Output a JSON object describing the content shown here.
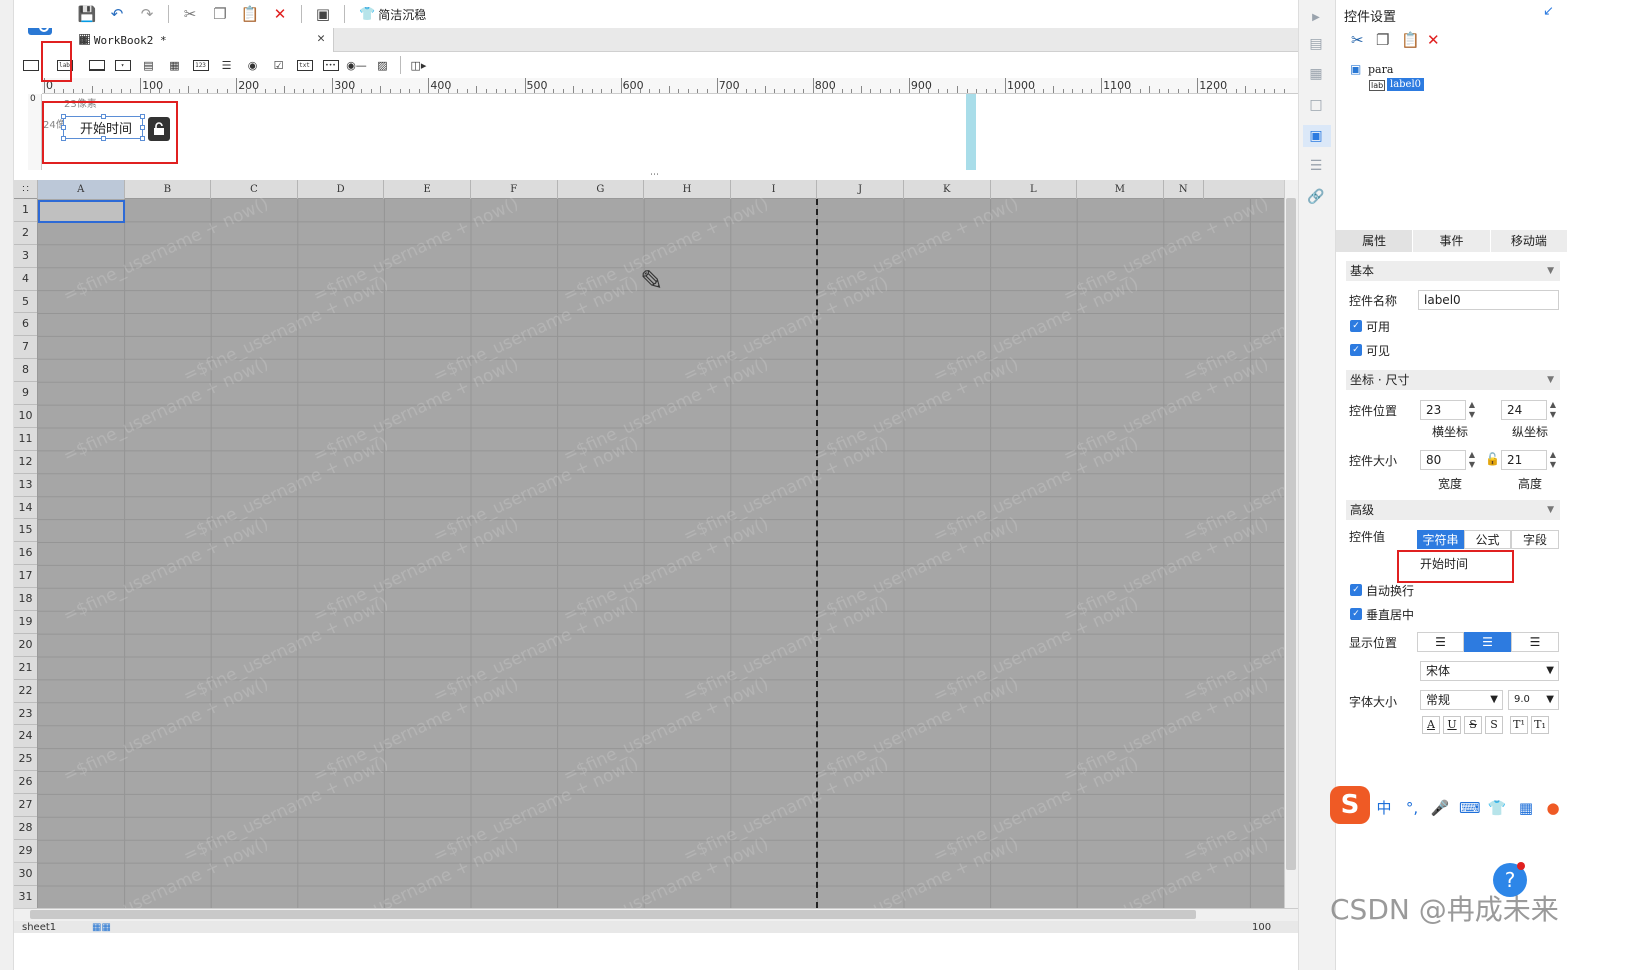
{
  "toolbar": {
    "simple_label": "简洁沉稳"
  },
  "tab": {
    "doc_name": "WorkBook2 *"
  },
  "ruler": {
    "labels": [
      "0",
      "100",
      "200",
      "300",
      "400",
      "500",
      "600",
      "700",
      "800",
      "900",
      "1000",
      "1100",
      "1200"
    ]
  },
  "param": {
    "label_text": "开始时间",
    "dim_h": "23像素",
    "dim_v": "24像素"
  },
  "grid": {
    "columns": [
      "A",
      "B",
      "C",
      "D",
      "E",
      "F",
      "G",
      "H",
      "I",
      "J",
      "K",
      "L",
      "M",
      "N"
    ],
    "rows": [
      "1",
      "2",
      "3",
      "4",
      "5",
      "6",
      "7",
      "8",
      "9",
      "10",
      "11",
      "12",
      "13",
      "14",
      "15",
      "16",
      "17",
      "18",
      "19",
      "20",
      "21",
      "22",
      "23",
      "24",
      "25",
      "26",
      "27",
      "28",
      "29",
      "30",
      "31"
    ],
    "watermark": "=$fine_username + now()"
  },
  "bottom": {
    "sheet_name": "sheet1",
    "zoom": "100"
  },
  "panel": {
    "title": "控件设置",
    "tree_root": "para",
    "tree_child": "label0",
    "tabs": [
      "属性",
      "事件",
      "移动端"
    ],
    "section_basic": "基本",
    "name_label": "控件名称",
    "name_value": "label0",
    "enabled": "可用",
    "visible": "可见",
    "section_coord": "坐标 · 尺寸",
    "pos_label": "控件位置",
    "pos_x": "23",
    "pos_y": "24",
    "x_caption": "横坐标",
    "y_caption": "纵坐标",
    "size_label": "控件大小",
    "width": "80",
    "height": "21",
    "w_caption": "宽度",
    "h_caption": "高度",
    "section_advanced": "高级",
    "value_label": "控件值",
    "value_types": [
      "字符串",
      "公式",
      "字段"
    ],
    "value_text": "开始时间",
    "auto_wrap": "自动换行",
    "v_center": "垂直居中",
    "display_pos": "显示位置",
    "font_family": "宋体",
    "font_size_label": "字体大小",
    "font_style": "常规",
    "font_size": "9.0",
    "fmt_buttons": [
      "A",
      "U",
      "S",
      "S",
      "T¹",
      "T₁"
    ]
  },
  "ime": {
    "lang": "中",
    "punct": "°,"
  },
  "footer": {
    "csdn": "CSDN @冉成未来"
  },
  "colors": {
    "accent": "#2d7be0",
    "highlight": "#e02020",
    "grid_bg": "#a6a6a6"
  }
}
